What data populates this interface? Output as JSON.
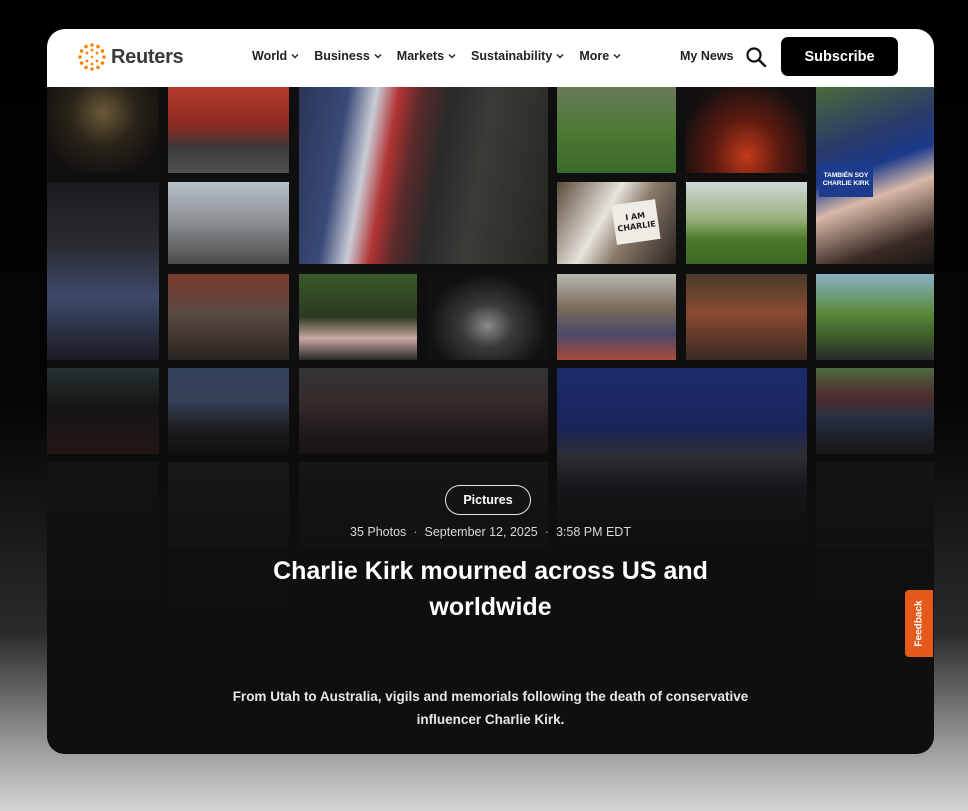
{
  "brand": {
    "name": "Reuters",
    "accent": "#ff8000"
  },
  "nav": {
    "items": [
      {
        "label": "World"
      },
      {
        "label": "Business"
      },
      {
        "label": "Markets"
      },
      {
        "label": "Sustainability"
      },
      {
        "label": "More"
      }
    ],
    "my_news": "My News",
    "search_icon": "search-icon",
    "subscribe_label": "Subscribe"
  },
  "gallery": {
    "tag": "Pictures",
    "photo_count": "35 Photos",
    "date": "September 12, 2025",
    "time": "3:58 PM EDT",
    "title": "Charlie Kirk mourned across US and worldwide",
    "description": "From Utah to Australia, vigils and memorials following the death of conservative influencer Charlie Kirk.",
    "sign_texts": [
      "I AM CHARLIE",
      "TAMBIÉN SOY CHARLIE KIRK"
    ]
  },
  "feedback_label": "Feedback",
  "colors": {
    "subscribe_bg": "#000000",
    "feedback_bg": "#e45a1a",
    "header_bg": "#ffffff"
  }
}
